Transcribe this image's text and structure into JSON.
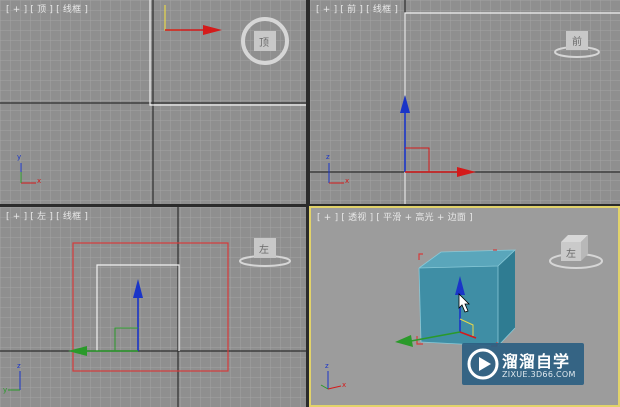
{
  "viewports": {
    "top": {
      "label": "[ + ] [ 顶 ] [ 线框 ]",
      "cube_face": "顶"
    },
    "front": {
      "label": "[ + ] [ 前 ] [ 线框 ]",
      "cube_face": "前"
    },
    "left": {
      "label": "[ + ] [ 左 ] [ 线框 ]",
      "cube_face": "左"
    },
    "perspective": {
      "label": "[ + ] [ 透视 ] [ 平滑 + 高光 + 边面 ]",
      "cube_face": "左"
    }
  },
  "axes": {
    "x": "x",
    "y": "y",
    "z": "z"
  },
  "watermark": {
    "title": "溜溜自学",
    "url": "ZIXUE.3D66.COM"
  },
  "colors": {
    "viewport_bg": "#8f8f8f",
    "persp_bg": "#9c9c9c",
    "grid": "#a3a3a3",
    "active_border": "#e2d36a",
    "gizmo_x": "#d41a1a",
    "gizmo_y": "#2a9a2a",
    "gizmo_z": "#1a35c8",
    "box_teal": "#3f8ea5",
    "selection_red": "#d63b3b"
  }
}
